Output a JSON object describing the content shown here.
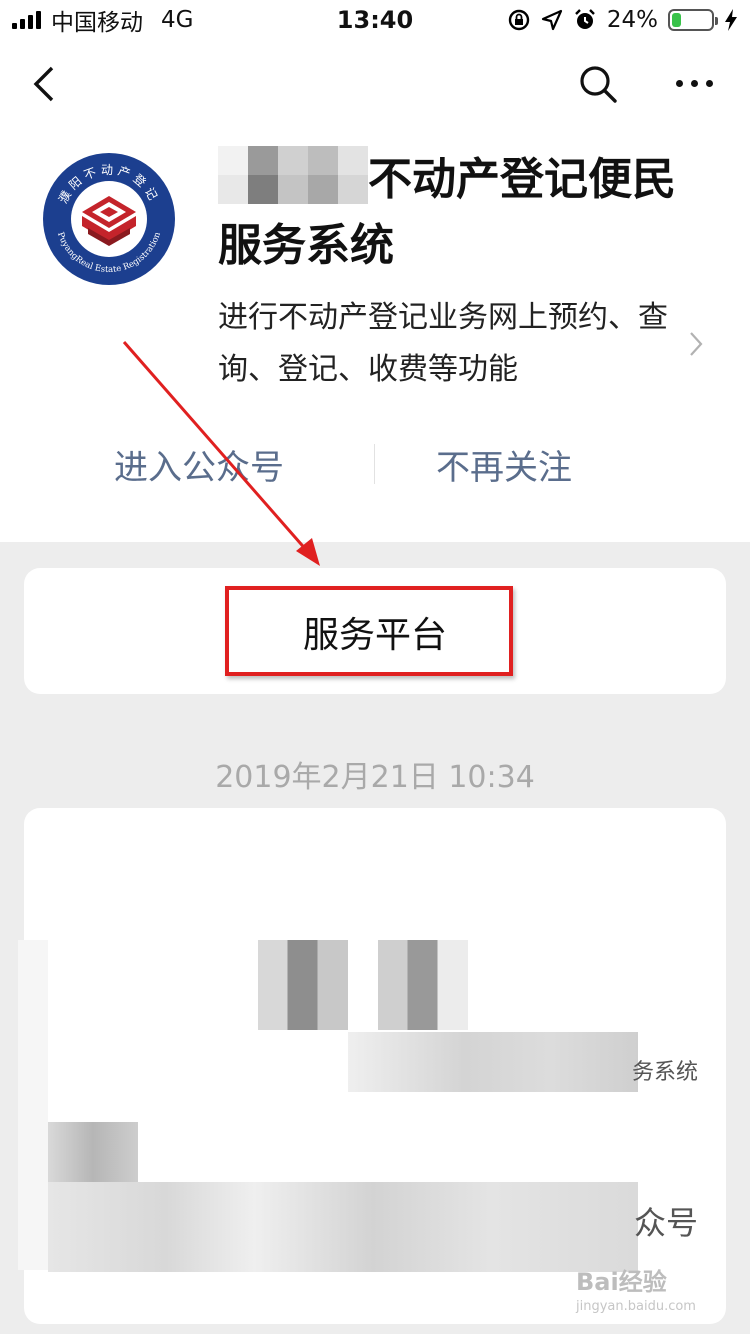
{
  "status_bar": {
    "carrier": "中国移动",
    "network": "4G",
    "time": "13:40",
    "battery": "24%",
    "battery_level": 0.24
  },
  "profile": {
    "title": "不动产登记便民服务系统",
    "description": "进行不动产登记业务网上预约、查询、登记、收费等功能",
    "logo_text_top": "濮阳不动产登记",
    "logo_text_bottom": "PuyangReal Estate Registration"
  },
  "actions": {
    "enter": "进入公众号",
    "unfollow": "不再关注"
  },
  "menu": {
    "service_platform": "服务平台"
  },
  "message": {
    "date": "2019年2月21日 10:34",
    "snippet_1": "务系统",
    "snippet_2": "众号"
  },
  "watermark": {
    "brand": "Bai经验",
    "url": "jingyan.baidu.com"
  },
  "colors": {
    "link": "#5a6d8c",
    "highlight": "#e02020",
    "battery": "#39c24a"
  }
}
